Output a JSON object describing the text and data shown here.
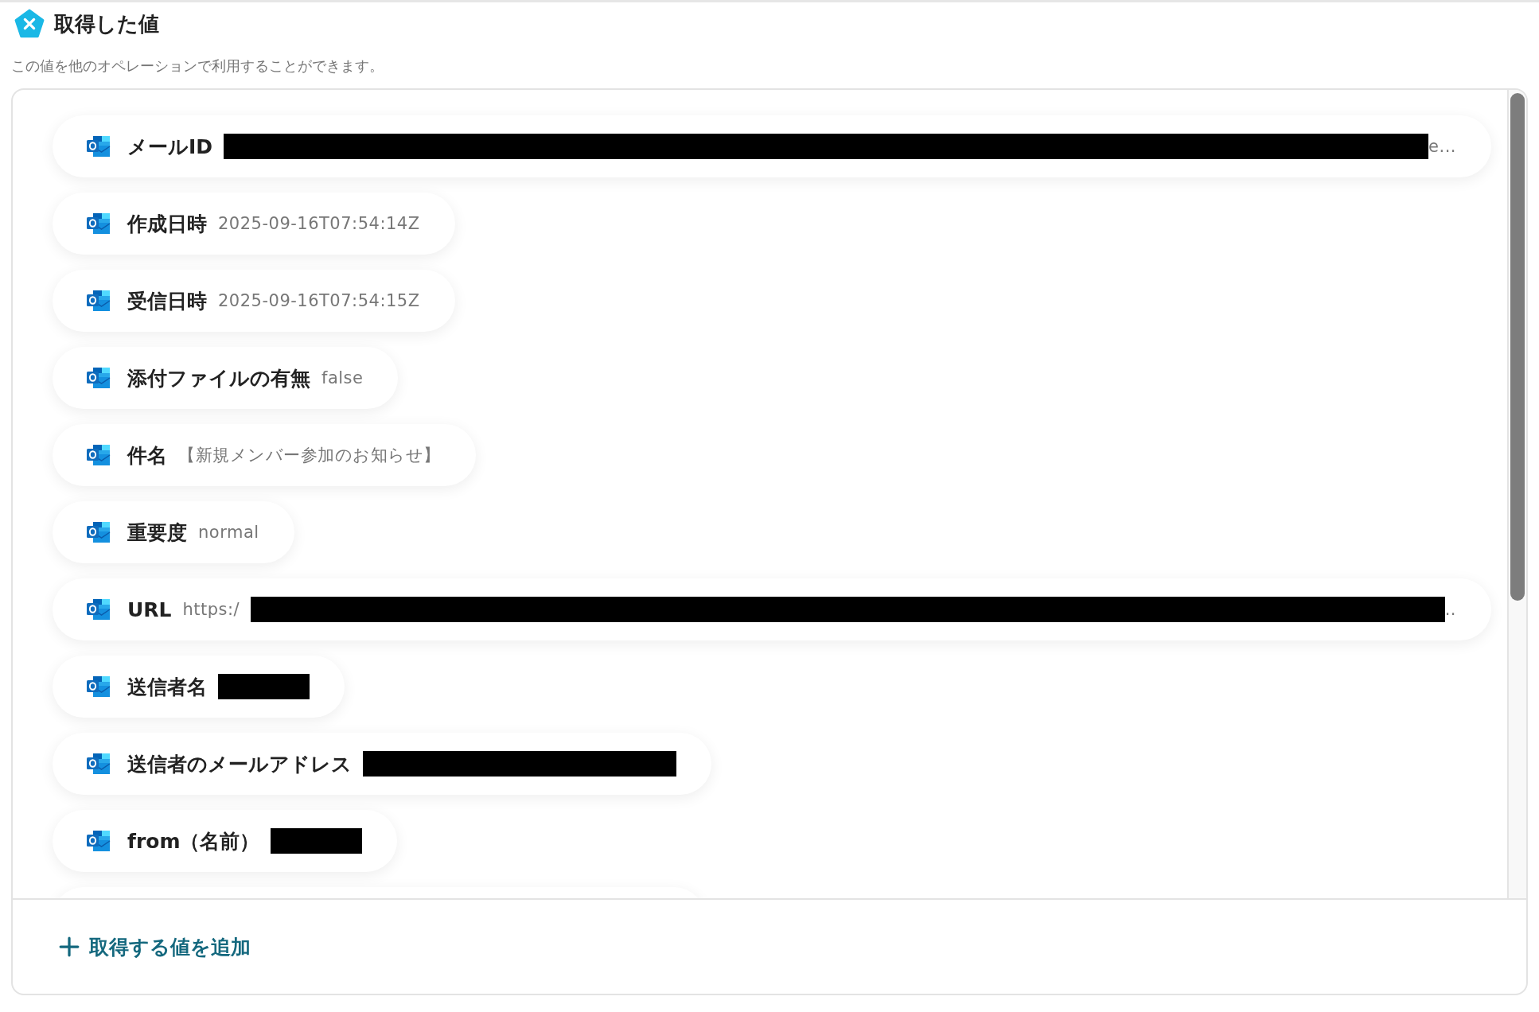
{
  "header": {
    "title": "取得した値",
    "subtitle": "この値を他のオペレーションで利用することができます。"
  },
  "values": [
    {
      "label": "メールID",
      "kind": "wide",
      "value_after": "e..."
    },
    {
      "label": "作成日時",
      "value": "2025-09-16T07:54:14Z",
      "kind": "plain"
    },
    {
      "label": "受信日時",
      "value": "2025-09-16T07:54:15Z",
      "kind": "plain"
    },
    {
      "label": "添付ファイルの有無",
      "value": "false",
      "kind": "plain"
    },
    {
      "label": "件名",
      "value": "【新規メンバー参加のお知らせ】",
      "kind": "plain"
    },
    {
      "label": "重要度",
      "value": "normal",
      "kind": "plain"
    },
    {
      "label": "URL",
      "value": "https:/",
      "kind": "wide",
      "value_after": ".."
    },
    {
      "label": "送信者名",
      "kind": "masked"
    },
    {
      "label": "送信者のメールアドレス",
      "kind": "longmasked"
    },
    {
      "label": "from（名前）",
      "kind": "masked"
    }
  ],
  "add_button": {
    "label": "取得する値を追加"
  }
}
